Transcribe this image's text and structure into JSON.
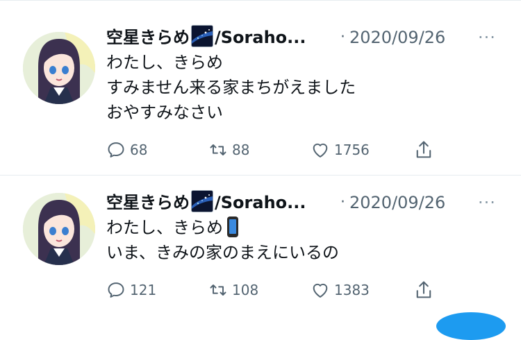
{
  "tweets": [
    {
      "name": "空星きらめ",
      "handle": "/Soraho...",
      "separator": "·",
      "date": "2020/09/26",
      "more": "···",
      "lines": [
        "わたし、きらめ",
        "すみません来る家まちがえました",
        "おやすみなさい"
      ],
      "replies": "68",
      "retweets": "88",
      "likes": "1756"
    },
    {
      "name": "空星きらめ",
      "handle": "/Soraho...",
      "separator": "·",
      "date": "2020/09/26",
      "more": "···",
      "lines": [
        "わたし、きらめ",
        "いま、きみの家のまえにいるの"
      ],
      "replies": "121",
      "retweets": "108",
      "likes": "1383"
    }
  ],
  "icons": {
    "reply": "speech-bubble",
    "retweet": "retweet-arrows",
    "like": "heart-outline",
    "share": "share-upload",
    "badge": "starry-sky-image",
    "emoji": "mobile-phone-emoji"
  },
  "colors": {
    "text": "#0f1419",
    "secondary": "#536471",
    "divider": "#e6ecf0",
    "accent": "#1d9bf0"
  }
}
